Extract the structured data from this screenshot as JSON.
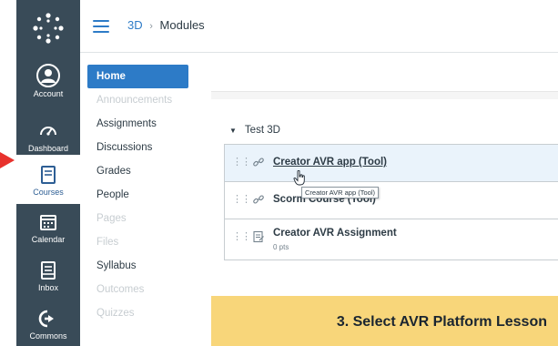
{
  "global_nav": {
    "items": [
      {
        "label": "Account",
        "icon": "account-avatar-icon"
      },
      {
        "label": "Dashboard",
        "icon": "dashboard-speedometer-icon"
      },
      {
        "label": "Courses",
        "icon": "courses-book-icon",
        "active": true
      },
      {
        "label": "Calendar",
        "icon": "calendar-icon"
      },
      {
        "label": "Inbox",
        "icon": "inbox-icon"
      },
      {
        "label": "Commons",
        "icon": "commons-arrow-icon"
      }
    ]
  },
  "breadcrumb": {
    "course": "3D",
    "separator": "›",
    "page": "Modules"
  },
  "course_nav": {
    "items": [
      {
        "label": "Home",
        "state": "active"
      },
      {
        "label": "Announcements",
        "state": "disabled"
      },
      {
        "label": "Assignments",
        "state": "normal"
      },
      {
        "label": "Discussions",
        "state": "normal"
      },
      {
        "label": "Grades",
        "state": "normal"
      },
      {
        "label": "People",
        "state": "normal"
      },
      {
        "label": "Pages",
        "state": "disabled"
      },
      {
        "label": "Files",
        "state": "disabled"
      },
      {
        "label": "Syllabus",
        "state": "normal"
      },
      {
        "label": "Outcomes",
        "state": "disabled"
      },
      {
        "label": "Quizzes",
        "state": "disabled"
      }
    ]
  },
  "module": {
    "title": "Test 3D",
    "items": [
      {
        "title": "Creator AVR app (Tool)",
        "icon": "link-icon"
      },
      {
        "title": "Scorm Course (Tool)",
        "icon": "link-icon"
      },
      {
        "title": "Creator AVR Assignment",
        "icon": "assignment-icon",
        "points": "0 pts"
      }
    ]
  },
  "tooltip": "Creator AVR app (Tool)",
  "banner": "3. Select AVR Platform Lesson",
  "colors": {
    "nav_bg": "#394b58",
    "link": "#2d7bc7",
    "highlight": "#eaf3fb",
    "banner": "#f8d67a",
    "arrow": "#e8322d"
  }
}
